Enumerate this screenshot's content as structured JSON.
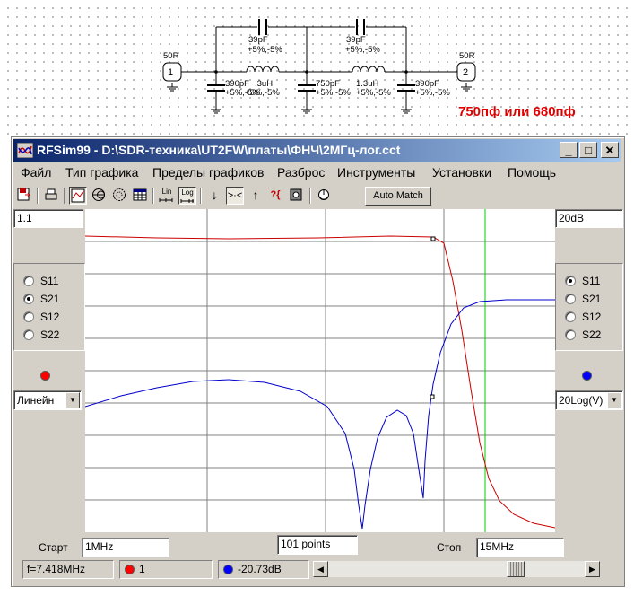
{
  "schematic": {
    "port1_label": "50R",
    "port1_number": "1",
    "port2_label": "50R",
    "port2_number": "2",
    "shunt_c1": "390pF",
    "shunt_c1_tol": "+5%,-5%",
    "series_c1": "39pF",
    "series_c1_tol": "+5%,-5%",
    "inductor1": ",3uH",
    "inductor1_tol": "+5%,-5%",
    "shunt_c2": "750pF",
    "shunt_c2_tol": "+5%,-5%",
    "series_c2": "39pF",
    "series_c2_tol": "+5%,-5%",
    "inductor2": "1.3uH",
    "inductor2_tol": "+5%,-5%",
    "shunt_c3": "390pF",
    "shunt_c3_tol": "+5%,-5%",
    "annotation": "750пф или 680пф"
  },
  "window": {
    "title": "RFSim99 - D:\\SDR-техника\\UT2FW\\платы\\ФНЧ\\2МГц-лог.cct",
    "minimize": "_",
    "maximize": "□",
    "close": "✕"
  },
  "menu": [
    "Файл",
    "Тип графика",
    "Пределы графиков",
    "Разброс",
    "Инструменты",
    "Установки",
    "Помощь"
  ],
  "toolbar": {
    "auto_match": "Auto Match",
    "lin_label": "Lin",
    "log_label": "Log"
  },
  "left_panel": {
    "scale_value": "1.1",
    "options": [
      "S11",
      "S21",
      "S12",
      "S22"
    ],
    "selected": "S21",
    "marker_color": "#ff0000",
    "mode": "Линейн"
  },
  "right_panel": {
    "scale_value": "20dB",
    "options": [
      "S11",
      "S21",
      "S12",
      "S22"
    ],
    "selected": "S11",
    "marker_color": "#0000ff",
    "mode": "20Log(V)"
  },
  "sweep": {
    "start_label": "Старт",
    "start_value": "1MHz",
    "points": "101 points",
    "stop_label": "Стоп",
    "stop_value": "15MHz"
  },
  "status": {
    "frequency": "f=7.418MHz",
    "red_value": "1",
    "blue_value": "-20.73dB"
  },
  "colors": {
    "red_trace": "#cc0000",
    "blue_trace": "#0000cc",
    "marker_line": "#00cc00",
    "title_bar": "#0a246a"
  }
}
